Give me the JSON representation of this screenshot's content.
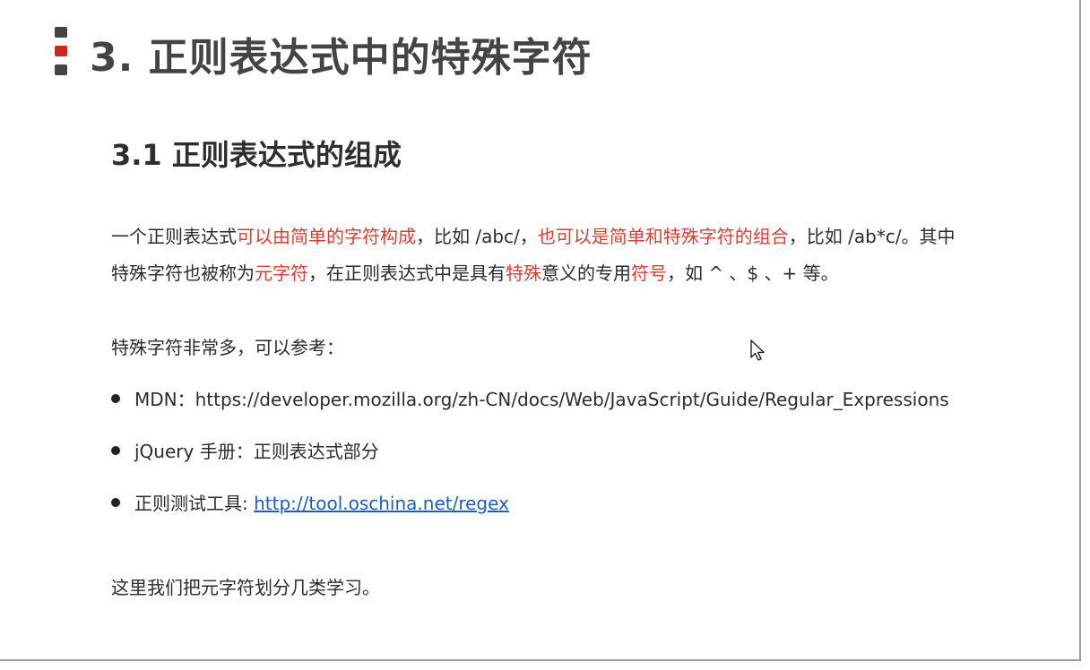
{
  "slide": {
    "title": "3. 正则表达式中的特殊字符",
    "bar_colors": [
      "#444444",
      "#d0261b",
      "#444444"
    ],
    "subtitle": "3.1 正则表达式的组成",
    "paragraph": {
      "line1": [
        {
          "text": "一个正则表达式",
          "highlight": false
        },
        {
          "text": "可以由简单的字符构成",
          "highlight": true
        },
        {
          "text": "，比如 /abc/，",
          "highlight": false
        },
        {
          "text": "也可以是简单和特殊字符的组合",
          "highlight": true
        },
        {
          "text": "，比如 /ab*c/。其中",
          "highlight": false
        }
      ],
      "line2": [
        {
          "text": "特殊字符也被称为",
          "highlight": false
        },
        {
          "text": "元字符",
          "highlight": true
        },
        {
          "text": "，在正则表达式中是具有",
          "highlight": false
        },
        {
          "text": "特殊",
          "highlight": true
        },
        {
          "text": "意义的专用",
          "highlight": false
        },
        {
          "text": "符号",
          "highlight": true
        },
        {
          "text": "，如 ^ 、$ 、+ 等。",
          "highlight": false
        }
      ]
    },
    "reference_intro": "特殊字符非常多，可以参考：",
    "references": [
      {
        "label": "MDN：https://developer.mozilla.org/zh-CN/docs/Web/JavaScript/Guide/Regular_Expressions"
      },
      {
        "label": "jQuery 手册：正则表达式部分"
      },
      {
        "label": "正则测试工具: ",
        "link": "http://tool.oschina.net/regex"
      }
    ],
    "closing": "这里我们把元字符划分几类学习。",
    "highlight_color": "#e23b2e",
    "link_color": "#1a5fbf"
  }
}
